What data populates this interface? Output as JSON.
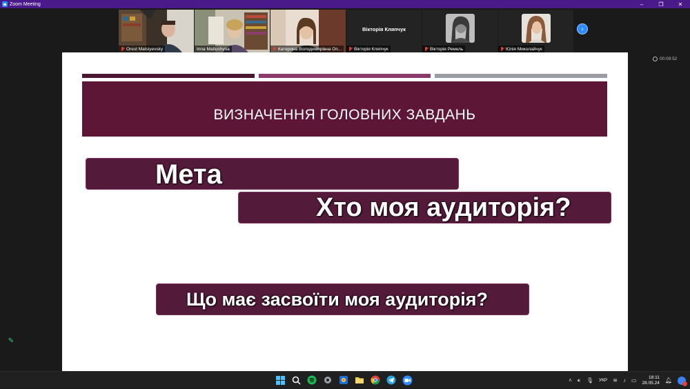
{
  "window": {
    "title": "Zoom Meeting",
    "controls": [
      "–",
      "❐",
      "✕"
    ]
  },
  "participants": [
    {
      "name": "Orest Matsiyevsky",
      "muted": true,
      "video": true
    },
    {
      "name": "Inna Matiushyna",
      "muted": false,
      "video": true
    },
    {
      "name": "Катерина Володимирівна Оп...",
      "muted": true,
      "video": true
    },
    {
      "name": "Вікторія Кляпчук",
      "muted": true,
      "video": false,
      "display_name": "Вікторія Кляпчук"
    },
    {
      "name": "Вікторія Ремель",
      "muted": true,
      "video": false
    },
    {
      "name": "Юлія Миколайчук",
      "muted": true,
      "video": false
    }
  ],
  "next_participants_icon": "chevron-right-icon",
  "timer": "00:09:52",
  "slide": {
    "banner_title": "ВИЗНАЧЕННЯ ГОЛОВНИХ ЗАВДАНЬ",
    "pills": [
      "Мета",
      "Хто моя аудиторія?",
      "Що має засвоїти моя аудиторія?"
    ],
    "colors": {
      "primary": "#5e1637",
      "secondary": "#8c3a6b",
      "grey": "#9a9da4"
    }
  },
  "annotate_icon": "pencil-icon",
  "taskbar": {
    "apps": [
      "windows-start-icon",
      "search-icon",
      "spotify-icon",
      "settings-icon",
      "photos-icon",
      "file-explorer-icon",
      "chrome-icon",
      "telegram-icon",
      "zoom-icon"
    ],
    "tray": {
      "language": "УКР",
      "time": "18:11",
      "date": "28.05.24"
    }
  }
}
